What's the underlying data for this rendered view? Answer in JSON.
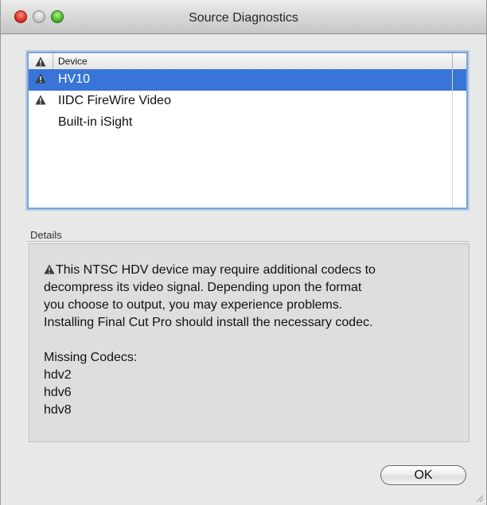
{
  "window": {
    "title": "Source Diagnostics"
  },
  "device_table": {
    "columns": [
      "",
      "Device"
    ],
    "rows": [
      {
        "warning": true,
        "device": "HV10",
        "selected": true
      },
      {
        "warning": true,
        "device": "IIDC FireWire Video",
        "selected": false
      },
      {
        "warning": false,
        "device": "Built-in iSight",
        "selected": false
      }
    ]
  },
  "details": {
    "label": "Details",
    "lines": [
      "This NTSC HDV device may require additional codecs to",
      "decompress its video signal.  Depending upon the format",
      "you choose to output, you may experience problems.",
      "Installing Final Cut Pro should install the necessary codec.",
      "",
      "Missing Codecs:",
      "hdv2",
      "hdv6",
      "hdv8"
    ]
  },
  "buttons": {
    "ok_label": "OK"
  },
  "icons": {
    "warning": "warning-triangle-icon"
  }
}
